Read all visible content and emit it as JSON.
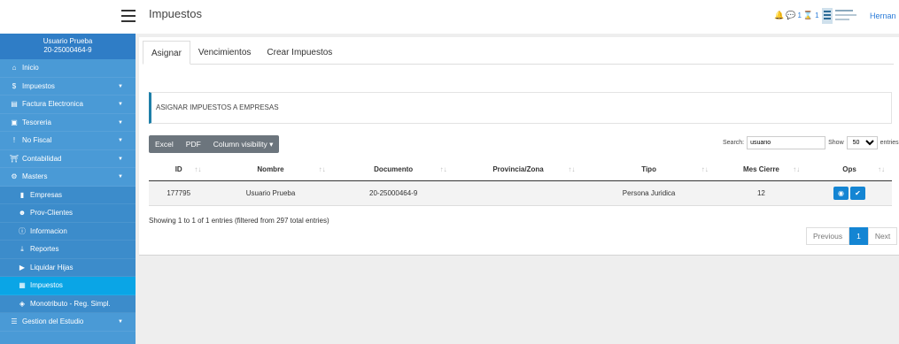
{
  "header": {
    "title": "Impuestos",
    "notif_count_1": "1",
    "notif_count_2": "1",
    "user": "Hernan"
  },
  "sidebar": {
    "user_name": "Usuario Prueba",
    "user_cuit": "20-25000464-9",
    "items": [
      {
        "label": "Inicio",
        "icon": "home-icon",
        "caret": false
      },
      {
        "label": "Impuestos",
        "icon": "dollar-icon",
        "caret": true
      },
      {
        "label": "Factura Electronica",
        "icon": "invoice-icon",
        "caret": true
      },
      {
        "label": "Tesoreria",
        "icon": "money-icon",
        "caret": true
      },
      {
        "label": "No Fiscal",
        "icon": "exclamation-icon",
        "caret": true
      },
      {
        "label": "Contabilidad",
        "icon": "bank-icon",
        "caret": true
      },
      {
        "label": "Masters",
        "icon": "gears-icon",
        "caret": true
      }
    ],
    "subitems": [
      {
        "label": "Empresas",
        "icon": "building-icon"
      },
      {
        "label": "Prov-Clientes",
        "icon": "users-icon"
      },
      {
        "label": "Informacion",
        "icon": "info-icon"
      },
      {
        "label": "Reportes",
        "icon": "download-icon"
      },
      {
        "label": "Liquidar Hijas",
        "icon": "play-icon"
      },
      {
        "label": "Impuestos",
        "icon": "calendar-icon"
      },
      {
        "label": "Monotributo - Reg. Simpl.",
        "icon": "tag-icon"
      }
    ],
    "bottom_item": {
      "label": "Gestion del Estudio",
      "icon": "list-icon"
    }
  },
  "tabs": [
    "Asignar",
    "Vencimientos",
    "Crear Impuestos"
  ],
  "section_title": "ASIGNAR IMPUESTOS A EMPRESAS",
  "export_buttons": {
    "excel": "Excel",
    "pdf": "PDF",
    "colvis": "Column visibility"
  },
  "search": {
    "label": "Search:",
    "value": "usuario",
    "show_label": "Show",
    "show_value": "50",
    "entries_label": "entries"
  },
  "table": {
    "headers": [
      "ID",
      "Nombre",
      "Documento",
      "Provincia/Zona",
      "Tipo",
      "Mes Cierre",
      "Ops"
    ],
    "rows": [
      {
        "id": "177795",
        "nombre": "Usuario Prueba",
        "documento": "20-25000464-9",
        "provincia": "",
        "tipo": "Persona Juridica",
        "mes_cierre": "12"
      }
    ]
  },
  "info_text": "Showing 1 to 1 of 1 entries (filtered from 297 total entries)",
  "pagination": {
    "previous": "Previous",
    "current": "1",
    "next": "Next"
  },
  "colors": {
    "sidebar": "#4a9ad6",
    "sidebar_header": "#2f7dc6",
    "active": "#0aa5e6",
    "primary": "#1485d3",
    "accent_bar": "#1e7fa8"
  }
}
